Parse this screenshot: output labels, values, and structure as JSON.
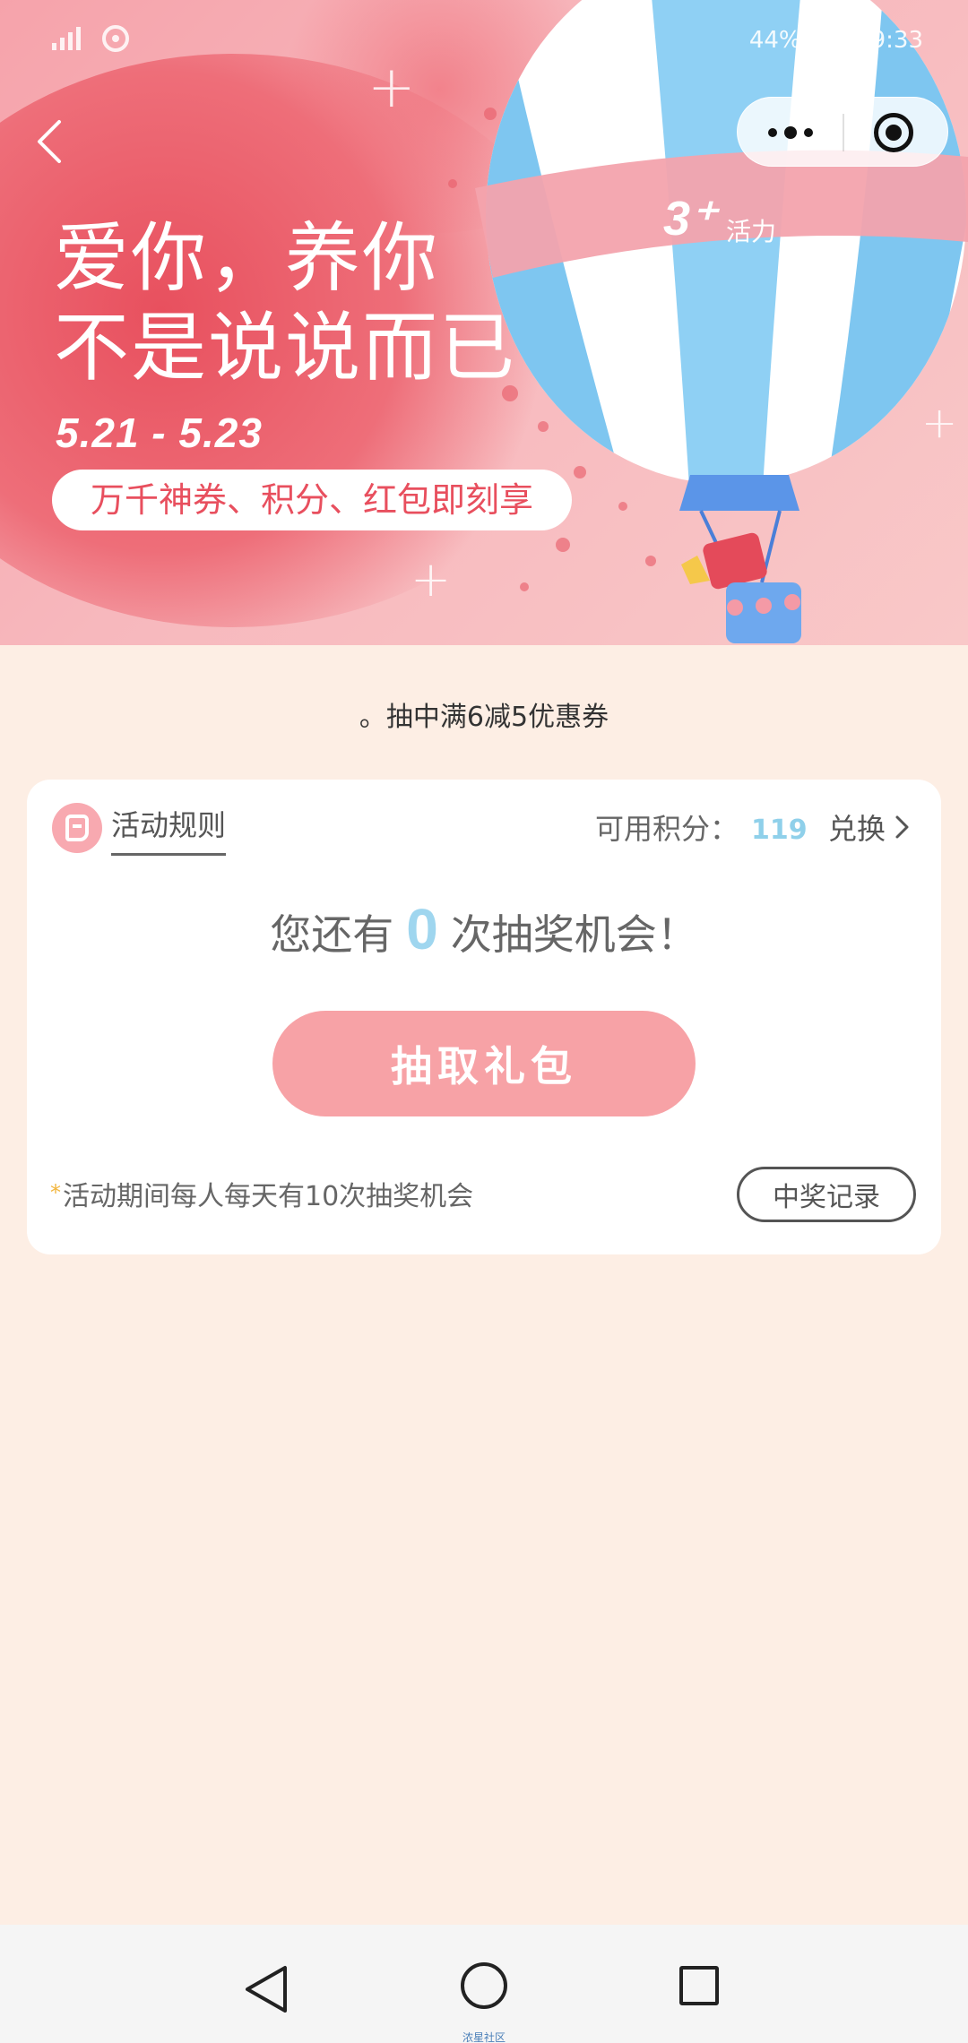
{
  "status_bar": {
    "battery": "44%",
    "time": "9:33"
  },
  "banner": {
    "headline_line1": "爱你，养你",
    "headline_line2": "不是说说而已",
    "date_range": "5.21 - 5.23",
    "benefit_text": "万千神券、积分、红包即刻享",
    "balloon_brand": "活力",
    "balloon_logo": "3⁺"
  },
  "notice": "。抽中满6减5优惠券",
  "card": {
    "rules_label": "活动规则",
    "points_label": "可用积分：",
    "points_value": "119",
    "exchange_label": "兑换",
    "chance_prefix": "您还有",
    "chance_count": "0",
    "chance_suffix": "次抽奖机会！",
    "draw_button": "抽取礼包",
    "note_star": "*",
    "note_text": "活动期间每人每天有10次抽奖机会",
    "record_button": "中奖记录"
  },
  "watermark": "浓星社区",
  "colors": {
    "page_bg": "#fdeee4",
    "accent_pink": "#f7a2a6",
    "points_blue": "#8fd0ea",
    "count_blue": "#9fd6ef"
  }
}
